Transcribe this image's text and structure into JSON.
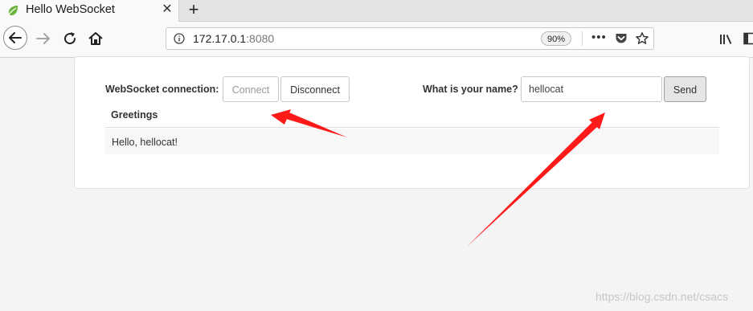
{
  "browser": {
    "tab_title": "Hello WebSocket",
    "tab_close_glyph": "✕",
    "new_tab_glyph": "+",
    "url_host": "172.17.0.1",
    "url_port": ":8080",
    "zoom": "90%",
    "more_glyph": "•••",
    "icons": [
      "spring-leaf-icon",
      "close-icon",
      "plus-icon",
      "back-icon",
      "forward-icon",
      "reload-icon",
      "home-icon",
      "info-icon",
      "more-icon",
      "pocket-icon",
      "star-icon",
      "library-icon",
      "sidebar-icon"
    ]
  },
  "form": {
    "connection_label": "WebSocket connection:",
    "connect_label": "Connect",
    "disconnect_label": "Disconnect",
    "name_label": "What is your name?",
    "name_value": "hellocat",
    "send_label": "Send"
  },
  "greetings": {
    "header": "Greetings",
    "rows": [
      "Hello, hellocat!"
    ]
  },
  "watermark": "https://blog.csdn.net/csacs",
  "colors": {
    "arrow": "#ff1a1a",
    "leaf": "#6db33f"
  }
}
